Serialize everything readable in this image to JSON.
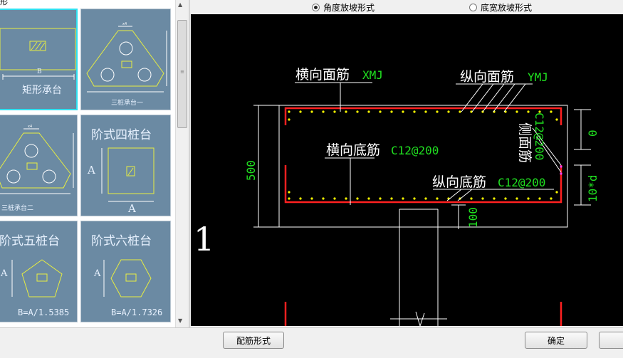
{
  "left_panel": {
    "label": "形",
    "tiles": [
      {
        "caption": "矩形承台",
        "dim": "B"
      },
      {
        "caption": "三桩承台一"
      },
      {
        "caption": "三桩承台二"
      },
      {
        "caption": "阶式四桩台",
        "dim": "A"
      },
      {
        "caption": "阶式五桩台",
        "dim": "A",
        "formula": "B=A/1.5385"
      },
      {
        "caption": "阶式六桩台",
        "dim": "A",
        "formula": "B=A/1.7326"
      }
    ]
  },
  "options": {
    "angle_slope": "角度放坡形式",
    "width_slope": "底宽放坡形式",
    "selected": "angle_slope"
  },
  "drawing": {
    "transverse_top": "横向面筋",
    "transverse_top_code": "XMJ",
    "longitudinal_top": "纵向面筋",
    "longitudinal_top_code": "YMJ",
    "transverse_bottom": "横向底筋",
    "transverse_bottom_code": "C12@200",
    "longitudinal_bottom": "纵向底筋",
    "longitudinal_bottom_code": "C12@200",
    "side_face": "侧面筋",
    "side_face_code": "C12@200",
    "height_dim": "500",
    "top_dim": "0",
    "anchor_dim": "10*d",
    "cover_dim": "100",
    "section_mark": "1"
  },
  "buttons": {
    "rebar_form": "配筋形式",
    "ok": "确定"
  },
  "colors": {
    "tile_bg": "#6b8aa3",
    "tile_line": "#e8ee40",
    "selected_border": "#2fe0f0",
    "rebar_red": "#ff2020",
    "rebar_dot": "#ffff00",
    "dim_green": "#20e020",
    "canvas_bg": "#000000"
  }
}
